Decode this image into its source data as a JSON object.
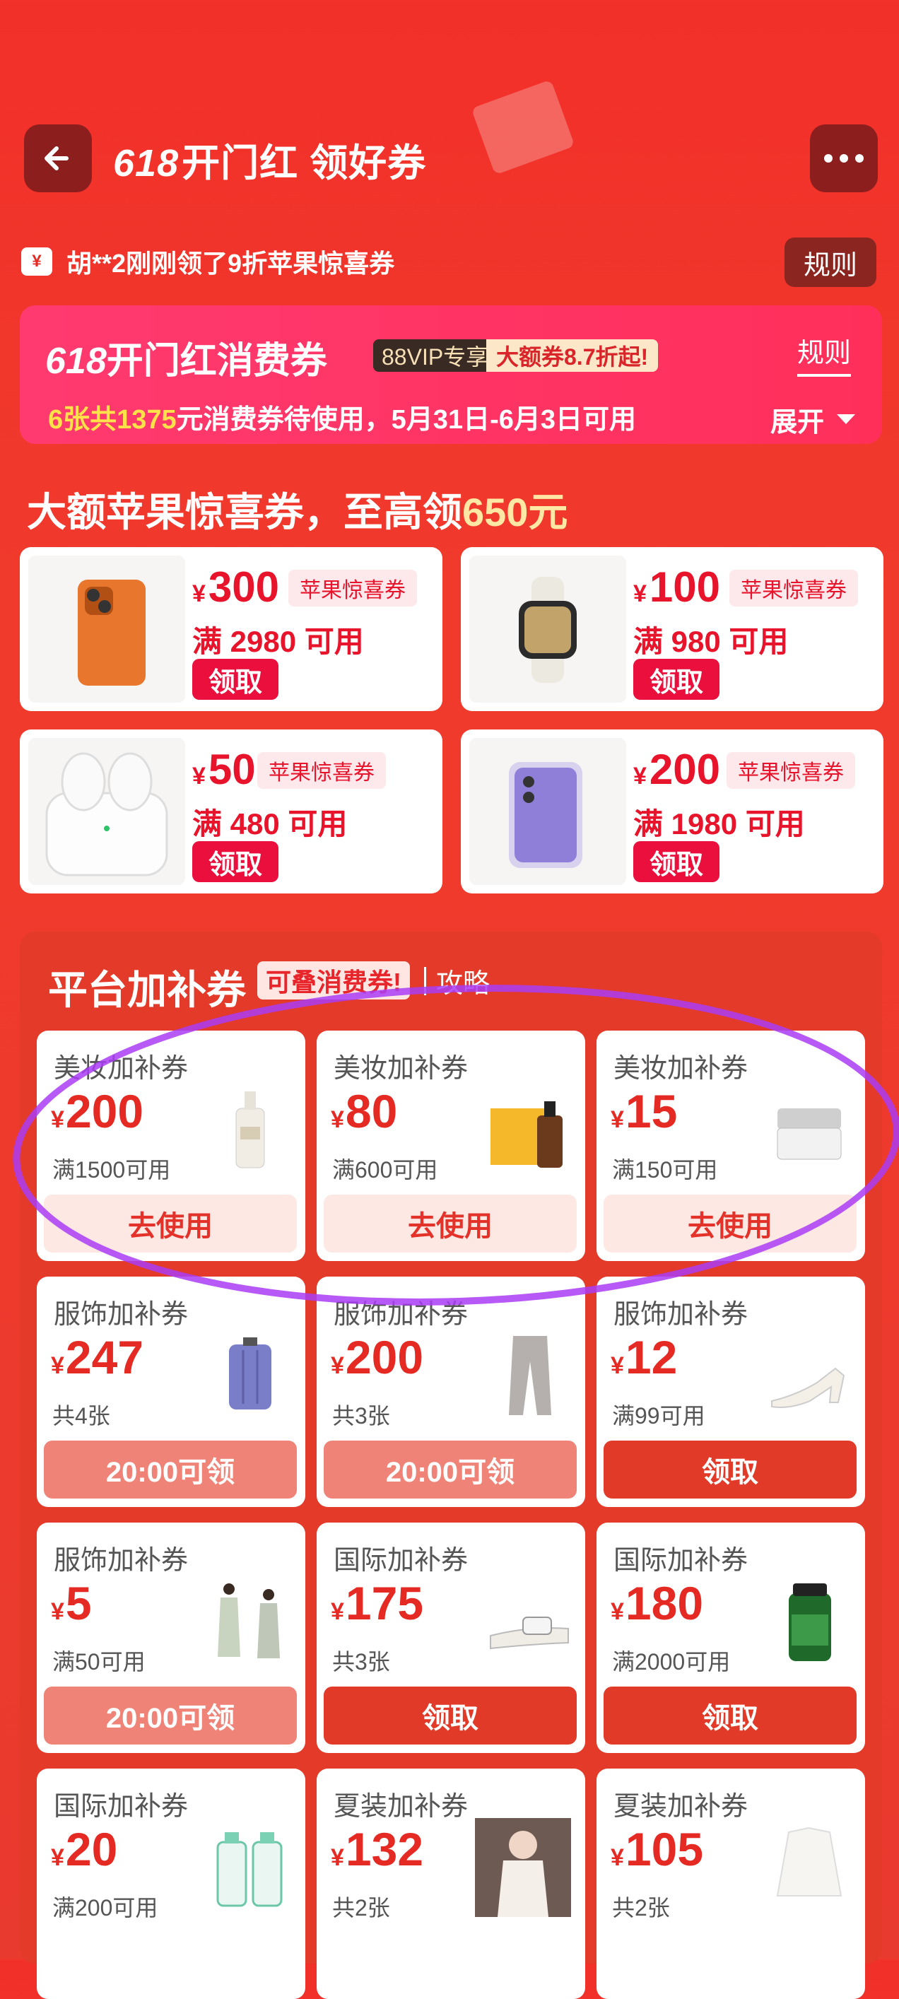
{
  "header": {
    "title_num": "618",
    "title_text": "开门红 领好券"
  },
  "ticker": {
    "text": "胡**2刚刚领了9折苹果惊喜券",
    "rules_label": "规则"
  },
  "consumer_banner": {
    "title_num": "618",
    "title_text": "开门红消费券",
    "vip_tag": "88VIP专享",
    "big_tag": "大额券8.7折起!",
    "rules_label": "规则",
    "sub_a": "6张共1375",
    "sub_b": "元消费券待使用，5月31日-6月3日可用",
    "expand_label": "展开"
  },
  "apple_section": {
    "heading_a": "大额苹果惊喜券，至高领",
    "heading_b": "650元",
    "cards": [
      {
        "amount": "300",
        "tag": "苹果惊喜券",
        "condition": "满 2980 可用",
        "button": "领取",
        "product": "phone-orange"
      },
      {
        "amount": "100",
        "tag": "苹果惊喜券",
        "condition": "满 980 可用",
        "button": "领取",
        "product": "watch"
      },
      {
        "amount": "50",
        "tag": "苹果惊喜券",
        "condition": "满 480 可用",
        "button": "领取",
        "product": "earbuds"
      },
      {
        "amount": "200",
        "tag": "苹果惊喜券",
        "condition": "满 1980 可用",
        "button": "领取",
        "product": "phone-purple"
      }
    ]
  },
  "currency": "¥",
  "platform": {
    "title": "平台加补券",
    "tag": "可叠消费券!",
    "guide": "攻略",
    "coupons": [
      {
        "category": "美妆加补券",
        "amount": "200",
        "condition": "满1500可用",
        "button": "去使用",
        "style": "use",
        "product": "bottle"
      },
      {
        "category": "美妆加补券",
        "amount": "80",
        "condition": "满600可用",
        "button": "去使用",
        "style": "use",
        "product": "perfume-box"
      },
      {
        "category": "美妆加补券",
        "amount": "15",
        "condition": "满150可用",
        "button": "去使用",
        "style": "use",
        "product": "cream-jar"
      },
      {
        "category": "服饰加补券",
        "amount": "247",
        "condition": "共4张",
        "button": "20:00可领",
        "style": "time",
        "product": "suitcase"
      },
      {
        "category": "服饰加补券",
        "amount": "200",
        "condition": "共3张",
        "button": "20:00可领",
        "style": "time",
        "product": "pants"
      },
      {
        "category": "服饰加补券",
        "amount": "12",
        "condition": "满99可用",
        "button": "领取",
        "style": "get",
        "product": "sandal"
      },
      {
        "category": "服饰加补券",
        "amount": "5",
        "condition": "满50可用",
        "button": "20:00可领",
        "style": "time",
        "product": "dresses"
      },
      {
        "category": "国际加补券",
        "amount": "175",
        "condition": "共3张",
        "button": "领取",
        "style": "get",
        "product": "slide-sandal"
      },
      {
        "category": "国际加补券",
        "amount": "180",
        "condition": "满2000可用",
        "button": "领取",
        "style": "get",
        "product": "supplement-bottle"
      },
      {
        "category": "国际加补券",
        "amount": "20",
        "condition": "满200可用",
        "button": "",
        "style": "none",
        "product": "micellar-water"
      },
      {
        "category": "夏装加补券",
        "amount": "132",
        "condition": "共2张",
        "button": "",
        "style": "none",
        "product": "model-photo"
      },
      {
        "category": "夏装加补券",
        "amount": "105",
        "condition": "共2张",
        "button": "",
        "style": "none",
        "product": "white-top"
      }
    ]
  },
  "colors": {
    "bg_red": "#f03a2c",
    "pink_banner": "#ff2f5a",
    "coupon_red": "#e8142c",
    "circle_purple": "#aa3cf5"
  }
}
